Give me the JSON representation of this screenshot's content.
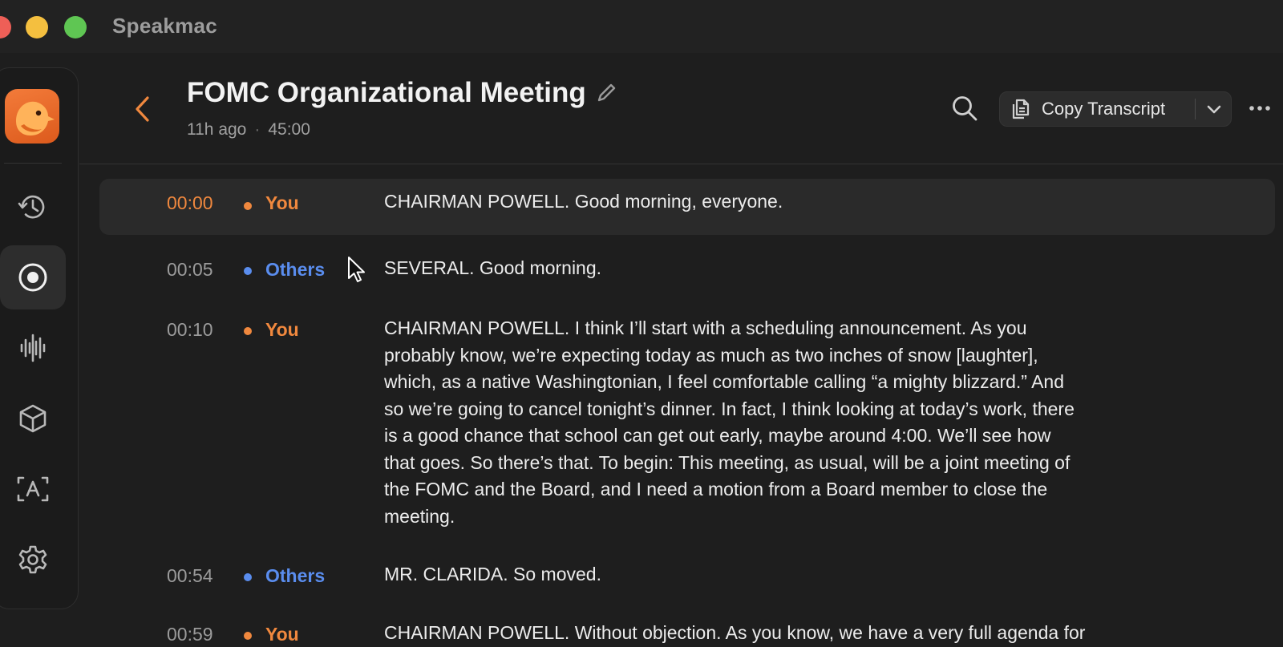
{
  "window": {
    "app_name": "Speakmac"
  },
  "sidebar": {
    "logo_icon": "bird-logo-icon",
    "items": [
      {
        "name": "history",
        "icon": "history-icon"
      },
      {
        "name": "record",
        "icon": "record-icon",
        "active": true
      },
      {
        "name": "waveform",
        "icon": "waveform-icon"
      },
      {
        "name": "models",
        "icon": "cube-icon"
      },
      {
        "name": "text",
        "icon": "text-box-icon"
      },
      {
        "name": "settings",
        "icon": "gear-icon"
      }
    ]
  },
  "header": {
    "title": "FOMC Organizational Meeting",
    "time_ago": "11h ago",
    "separator": "·",
    "duration": "45:00",
    "copy_button_label": "Copy Transcript"
  },
  "colors": {
    "accent": "#f0883e",
    "others": "#5a8dee",
    "background": "#1e1e1e"
  },
  "transcript": [
    {
      "time": "00:00",
      "speaker": "You",
      "text": "CHAIRMAN POWELL. Good morning, everyone."
    },
    {
      "time": "00:05",
      "speaker": "Others",
      "text": "SEVERAL. Good morning."
    },
    {
      "time": "00:10",
      "speaker": "You",
      "text_lines": [
        "CHAIRMAN POWELL. I think I’ll start with a scheduling announcement. As you",
        "probably know, we’re expecting today as much as two inches of snow [laughter],",
        "which, as a native Washingtonian, I feel comfortable calling “a mighty blizzard.” And",
        "so we’re going to cancel tonight’s dinner. In fact, I think looking at today’s work, there",
        "is a good chance that school can get out early, maybe around 4:00. We’ll see how",
        "that goes. So there’s that. To begin: This meeting, as usual, will be a joint meeting of",
        "the FOMC and the Board, and I need a motion from a Board member to close the",
        "meeting."
      ]
    },
    {
      "time": "00:54",
      "speaker": "Others",
      "text": "MR. CLARIDA. So moved."
    },
    {
      "time": "00:59",
      "speaker": "You",
      "text": "CHAIRMAN POWELL. Without objection. As you know, we have a very full agenda for"
    }
  ]
}
